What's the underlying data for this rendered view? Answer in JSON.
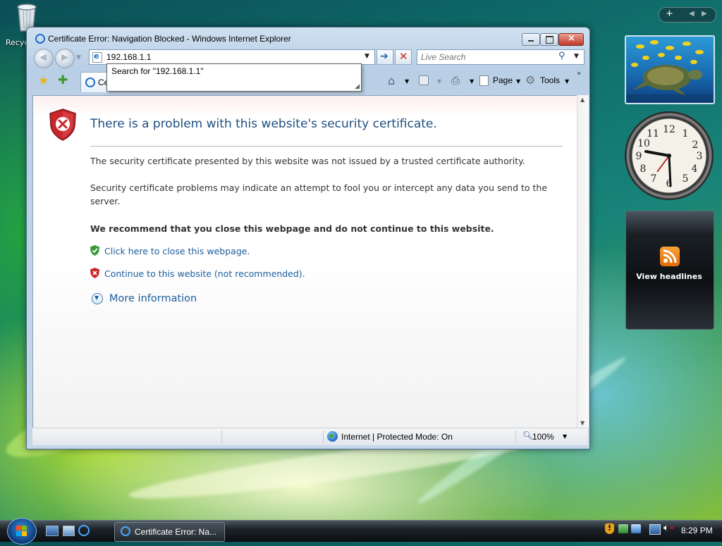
{
  "desktop": {
    "recycle_bin_label": "Recyc",
    "feed_gadget_label": "View headlines"
  },
  "window": {
    "title": "Certificate Error: Navigation Blocked - Windows Internet Explorer",
    "address": "192.168.1.1",
    "search_placeholder": "Live Search",
    "autocomplete_suggestion": "Search for \"192.168.1.1\"",
    "tab_label": "Ce",
    "commands": {
      "page": "Page",
      "tools": "Tools"
    }
  },
  "page": {
    "heading": "There is a problem with this website's security certificate.",
    "para1": "The security certificate presented by this website was not issued by a trusted certificate authority.",
    "para2": "Security certificate problems may indicate an attempt to fool you or intercept any data you send to the server.",
    "recommendation": "We recommend that you close this webpage and do not continue to this website.",
    "close_link": "Click here to close this webpage.",
    "continue_link": "Continue to this website (not recommended).",
    "more_info": "More information"
  },
  "status": {
    "zone": "Internet | Protected Mode: On",
    "zoom": "100%"
  },
  "taskbar": {
    "window_button": "Certificate Error: Na...",
    "time": "8:29 PM"
  },
  "colors": {
    "link": "#1b5e9d",
    "heading": "#1d4f80",
    "shield_red": "#c8262b",
    "shield_green": "#3a9a3a"
  }
}
